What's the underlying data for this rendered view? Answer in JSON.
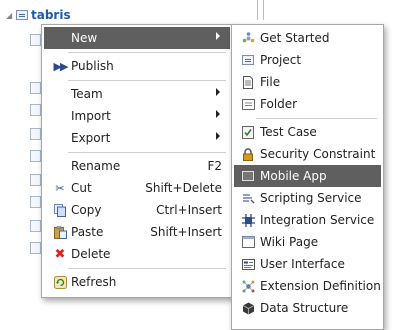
{
  "tree": {
    "root_label": "tabris"
  },
  "context_menu": {
    "new_label": "New",
    "publish_label": "Publish",
    "team_label": "Team",
    "import_label": "Import",
    "export_label": "Export",
    "rename_label": "Rename",
    "rename_shortcut": "F2",
    "cut_label": "Cut",
    "cut_shortcut": "Shift+Delete",
    "copy_label": "Copy",
    "copy_shortcut": "Ctrl+Insert",
    "paste_label": "Paste",
    "paste_shortcut": "Shift+Insert",
    "delete_label": "Delete",
    "refresh_label": "Refresh"
  },
  "new_submenu": {
    "items": [
      {
        "label": "Get Started",
        "icon": "get-started-icon"
      },
      {
        "label": "Project",
        "icon": "project-icon"
      },
      {
        "label": "File",
        "icon": "file-icon"
      },
      {
        "label": "Folder",
        "icon": "folder-icon"
      },
      {
        "label": "Test Case",
        "icon": "test-case-icon"
      },
      {
        "label": "Security Constraint",
        "icon": "lock-icon"
      },
      {
        "label": "Mobile App",
        "icon": "mobile-app-icon"
      },
      {
        "label": "Scripting Service",
        "icon": "scripting-service-icon"
      },
      {
        "label": "Integration Service",
        "icon": "integration-service-icon"
      },
      {
        "label": "Wiki Page",
        "icon": "wiki-page-icon"
      },
      {
        "label": "User Interface",
        "icon": "user-interface-icon"
      },
      {
        "label": "Extension Definition",
        "icon": "extension-definition-icon"
      },
      {
        "label": "Data Structure",
        "icon": "data-structure-icon"
      }
    ],
    "highlighted": "Mobile App"
  },
  "colors": {
    "highlight": "#5f5f5f",
    "link": "#1b5bb5",
    "delete": "#d9241c"
  }
}
